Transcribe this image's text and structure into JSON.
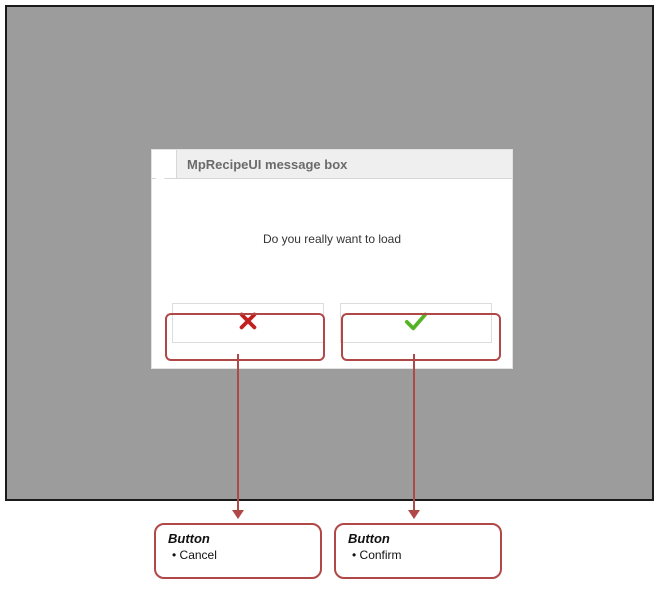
{
  "dialog": {
    "title": "MpRecipeUI message box",
    "message": "Do you really want to load"
  },
  "annotations": {
    "cancel": {
      "heading": "Button",
      "label": "Cancel"
    },
    "confirm": {
      "heading": "Button",
      "label": "Confirm"
    }
  },
  "colors": {
    "highlight": "#b04848",
    "app_background": "#9c9c9c",
    "cancel_icon": "#c62323",
    "confirm_icon": "#5bb72b"
  }
}
